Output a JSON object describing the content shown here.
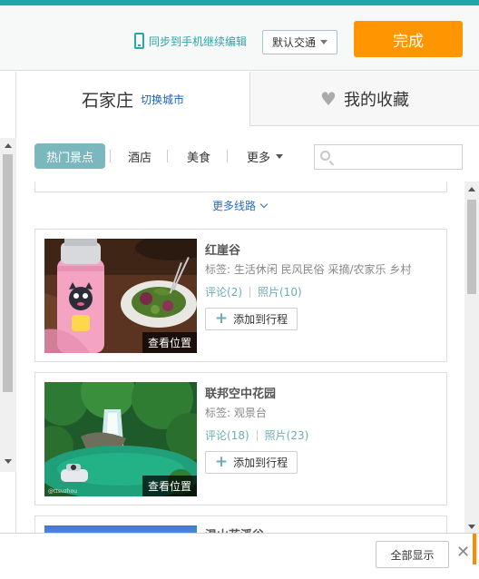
{
  "header": {
    "sync_label": "同步到手机继续编辑",
    "transport_label": "默认交通",
    "done_label": "完成"
  },
  "tabs": {
    "city": "石家庄",
    "switch_city": "切换城市",
    "favorites": "我的收藏"
  },
  "filters": {
    "items": [
      "热门景点",
      "酒店",
      "美食",
      "更多"
    ],
    "active": "热门景点",
    "search_placeholder": ""
  },
  "list": {
    "more_routes": "更多线路",
    "cards": [
      {
        "title": "红崖谷",
        "tags": "标签: 生活休闲 民风民俗 采摘/农家乐 乡村",
        "comments": "评论(2)",
        "photos": "照片(10)",
        "add_label": "添加到行程",
        "view_location": "查看位置"
      },
      {
        "title": "联邦空中花园",
        "tags": "标签: 观景台",
        "comments": "评论(18)",
        "photos": "照片(23)",
        "add_label": "添加到行程",
        "view_location": "查看位置"
      },
      {
        "title": "温山花溪谷"
      }
    ]
  },
  "footer": {
    "show_all": "全部显示",
    "close": "✕"
  },
  "colors": {
    "accent": "#1fa8a9",
    "done_button": "#ff9500",
    "link": "#2a6cc4",
    "chip_active": "#7ab8be"
  }
}
